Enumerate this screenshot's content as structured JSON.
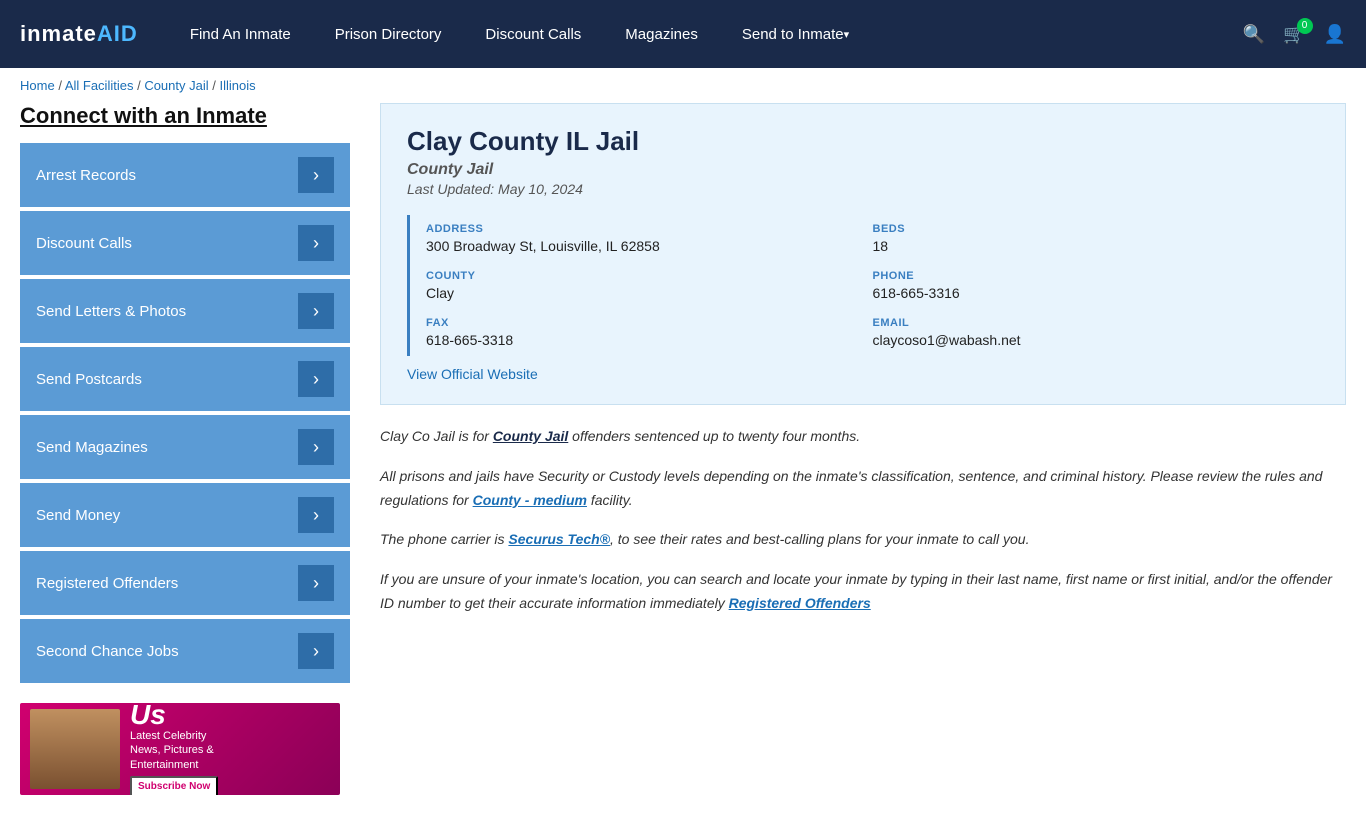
{
  "header": {
    "logo": "inmateAID",
    "logo_colored": "AID",
    "nav": [
      {
        "label": "Find An Inmate",
        "dropdown": false
      },
      {
        "label": "Prison Directory",
        "dropdown": false
      },
      {
        "label": "Discount Calls",
        "dropdown": false
      },
      {
        "label": "Magazines",
        "dropdown": false
      },
      {
        "label": "Send to Inmate",
        "dropdown": true
      }
    ],
    "cart_count": "0"
  },
  "breadcrumb": {
    "home": "Home",
    "all_facilities": "All Facilities",
    "county_jail": "County Jail",
    "state": "Illinois"
  },
  "sidebar": {
    "title": "Connect with an Inmate",
    "items": [
      {
        "label": "Arrest Records"
      },
      {
        "label": "Discount Calls"
      },
      {
        "label": "Send Letters & Photos"
      },
      {
        "label": "Send Postcards"
      },
      {
        "label": "Send Magazines"
      },
      {
        "label": "Send Money"
      },
      {
        "label": "Registered Offenders"
      },
      {
        "label": "Second Chance Jobs"
      }
    ]
  },
  "ad": {
    "brand": "Us",
    "tagline": "Latest Celebrity\nNews, Pictures &\nEntertainment",
    "subscribe": "Subscribe Now"
  },
  "facility": {
    "name": "Clay County IL Jail",
    "type": "County Jail",
    "last_updated": "Last Updated: May 10, 2024",
    "address_label": "ADDRESS",
    "address_value": "300 Broadway St, Louisville, IL 62858",
    "beds_label": "BEDS",
    "beds_value": "18",
    "county_label": "COUNTY",
    "county_value": "Clay",
    "phone_label": "PHONE",
    "phone_value": "618-665-3316",
    "fax_label": "FAX",
    "fax_value": "618-665-3318",
    "email_label": "EMAIL",
    "email_value": "claycoso1@wabash.net",
    "website_link": "View Official Website"
  },
  "description": {
    "para1_start": "Clay Co Jail is for ",
    "para1_highlight": "County Jail",
    "para1_end": " offenders sentenced up to twenty four months.",
    "para2": "All prisons and jails have Security or Custody levels depending on the inmate's classification, sentence, and criminal history. Please review the rules and regulations for ",
    "para2_highlight": "County - medium",
    "para2_end": " facility.",
    "para3_start": "The phone carrier is ",
    "para3_highlight": "Securus Tech®",
    "para3_end": ", to see their rates and best-calling plans for your inmate to call you.",
    "para4": "If you are unsure of your inmate's location, you can search and locate your inmate by typing in their last name, first name or first initial, and/or the offender ID number to get their accurate information immediately",
    "para4_highlight": "Registered Offenders"
  }
}
